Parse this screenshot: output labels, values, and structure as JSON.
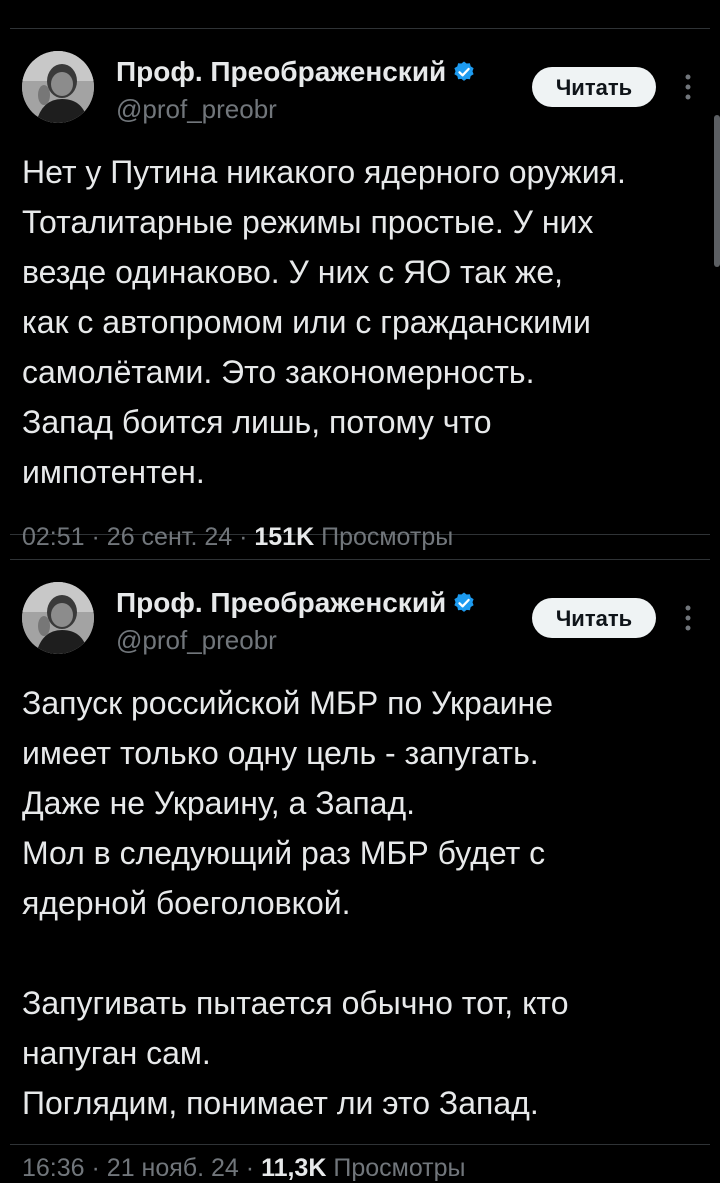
{
  "tweets": [
    {
      "author": {
        "display_name": "Проф. Преображенский",
        "handle": "@prof_preobr",
        "verified": true
      },
      "follow_label": "Читать",
      "text_lines": [
        "Нет у Путина никакого ядерного оружия.",
        "Тоталитарные режимы простые. У них",
        "везде одинаково. У них с ЯО так же,",
        "как с автопромом или с гражданскими",
        "самолётами. Это закономерность.",
        "Запад боится лишь, потому что",
        "импотентен."
      ],
      "time": "02:51",
      "date": "26 сент. 24",
      "views": "151K",
      "views_label": "Просмотры"
    },
    {
      "author": {
        "display_name": "Проф. Преображенский",
        "handle": "@prof_preobr",
        "verified": true
      },
      "follow_label": "Читать",
      "text_lines": [
        "Запуск российской МБР по Украине",
        "имеет только одну цель - запугать.",
        "Даже не Украину, а Запад.",
        "Мол в следующий раз МБР будет с",
        "ядерной боеголовкой.",
        "",
        "Запугивать пытается обычно тот, кто",
        "напуган сам.",
        "Поглядим, понимает ли это Запад."
      ],
      "time": "16:36",
      "date": "21 нояб. 24",
      "views": "11,3K",
      "views_label": "Просмотры"
    }
  ],
  "colors": {
    "background": "#000000",
    "text_primary": "#e7e9ea",
    "text_secondary": "#71767b",
    "verified_badge": "#1d9bf0",
    "follow_button_bg": "#eff3f4",
    "divider": "#2f3336"
  },
  "icons": {
    "verified": "verified-badge-icon",
    "more": "more-vertical-icon"
  }
}
